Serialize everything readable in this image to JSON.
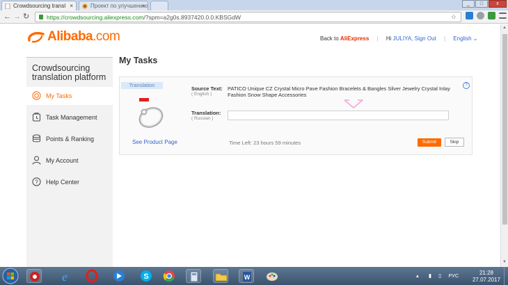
{
  "browser": {
    "tabs": [
      {
        "label": "Crowdsourcing transl"
      },
      {
        "label": "Проект по улучшению"
      }
    ],
    "window_controls": {
      "minimize": "_",
      "maximize": "□",
      "close": "x"
    },
    "url_host": "https://crowdsourcing.aliexpress.com",
    "url_path": "/?spm=a2g0s.8937420.0.0.KBSGdW"
  },
  "header": {
    "logo_brand": "Alibaba",
    "logo_com": ".com",
    "back_to": "Back to",
    "aliexpress": "AliExpress",
    "hi": "Hi",
    "user": "JULIYA,",
    "sign_out": "Sign Out",
    "language": "English"
  },
  "sidebar": {
    "title_line1": "Crowdsourcing",
    "title_line2": "translation platform",
    "items": [
      {
        "label": "My Tasks",
        "icon": "target-icon",
        "active": true
      },
      {
        "label": "Task Management",
        "icon": "clipboard-icon",
        "active": false
      },
      {
        "label": "Points & Ranking",
        "icon": "database-icon",
        "active": false
      },
      {
        "label": "My Account",
        "icon": "user-icon",
        "active": false
      },
      {
        "label": "Help Center",
        "icon": "question-icon",
        "active": false
      }
    ]
  },
  "main": {
    "title": "My Tasks",
    "task": {
      "tag": "Translation",
      "see_product": "See Product Page",
      "source_label": "Source Text:",
      "source_lang": "( English )",
      "source_text": "PATICO Unique CZ Crystal Micro Pave Fashion Bracelets & Bangles Silver Jewelry Crystal Inlay Fashion Snow Shape Accessories",
      "translation_label": "Translation:",
      "translation_lang": "( Russian )",
      "translation_value": "",
      "time_left": "Time Left: 23 hours 59 minutes",
      "submit": "Submit",
      "skip": "Skip",
      "help": "?"
    }
  },
  "taskbar": {
    "language": "РУС",
    "time": "21:28",
    "date": "27.07.2017"
  },
  "colors": {
    "accent": "#ff6a00",
    "link": "#3366cc",
    "ali_red": "#e62e04"
  }
}
